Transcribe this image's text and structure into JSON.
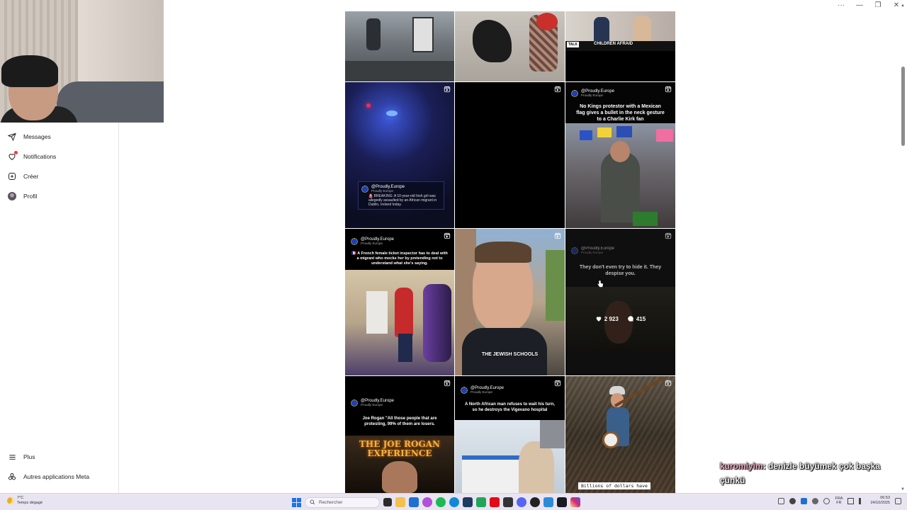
{
  "window_controls": {
    "more": "···",
    "minimize": "—",
    "restore": "❐",
    "close": "✕"
  },
  "sidebar": {
    "items": [
      {
        "label": "Messages",
        "icon": "paper-plane-icon"
      },
      {
        "label": "Notifications",
        "icon": "heart-icon"
      },
      {
        "label": "Créer",
        "icon": "plus-square-icon"
      },
      {
        "label": "Profil",
        "icon": "avatar"
      }
    ],
    "bottom_items": [
      {
        "label": "Plus",
        "icon": "menu-icon"
      },
      {
        "label": "Autres applications Meta",
        "icon": "meta-apps-icon"
      }
    ]
  },
  "grid": {
    "tiles": [
      {
        "caption": ""
      },
      {
        "caption": ""
      },
      {
        "caption": "CHILDREN AFRAID",
        "badge": "TALK"
      },
      {
        "handle": "@Proudly.Europe",
        "sub": "Proudly Europe",
        "caption": "🚨 BREAKING: A 10-year-old Irish girl was allegedly assaulted by an African migrant in Dublin, Ireland today."
      },
      {
        "caption": ""
      },
      {
        "handle": "@Proudly.Europe",
        "sub": "Proudly Europe",
        "caption": "No Kings protestor with a Mexican flag gives a bullet in the neck gesture to a Charlie Kirk fan"
      },
      {
        "handle": "@Proudly.Europe",
        "sub": "Proudly Europe",
        "caption": "🇫🇷 A French female ticket inspector has to deal with a migrant who mocks her by pretending not to understand what she's saying."
      },
      {
        "caption": "THE JEWISH SCHOOLS"
      },
      {
        "handle": "@Proudly.Europe",
        "sub": "Proudly Europe",
        "caption": "They don't even try to hide it. They despise you.",
        "likes": "2 923",
        "comments": "415"
      },
      {
        "handle": "@Proudly.Europe",
        "sub": "Proudly Europe",
        "caption": "Joe Rogan \"All those people that are protesting, 99% of them are losers.",
        "sign": "THE JOE ROGAN EXPERIENCE"
      },
      {
        "handle": "@Proudly.Europe",
        "sub": "Proudly Europe",
        "caption": "A North African man refuses to wait his turn, so he destroys the Vigevano hospital"
      },
      {
        "caption": "Billions of dollars have"
      }
    ]
  },
  "chat": {
    "user": "kuromiyim",
    "message": ": denizle büyümek çok başka çünkü"
  },
  "taskbar": {
    "weather_temp": "7°C",
    "weather_desc": "Temps dégagé",
    "search_placeholder": "Rechercher",
    "lang_top": "FRA",
    "lang_bottom": "FR",
    "time": "06:53",
    "date": "24/10/2025"
  },
  "colors": {
    "accent_red": "#ff3040",
    "eu_blue": "#1d3fb8",
    "taskbar": "#e9e4f1"
  }
}
